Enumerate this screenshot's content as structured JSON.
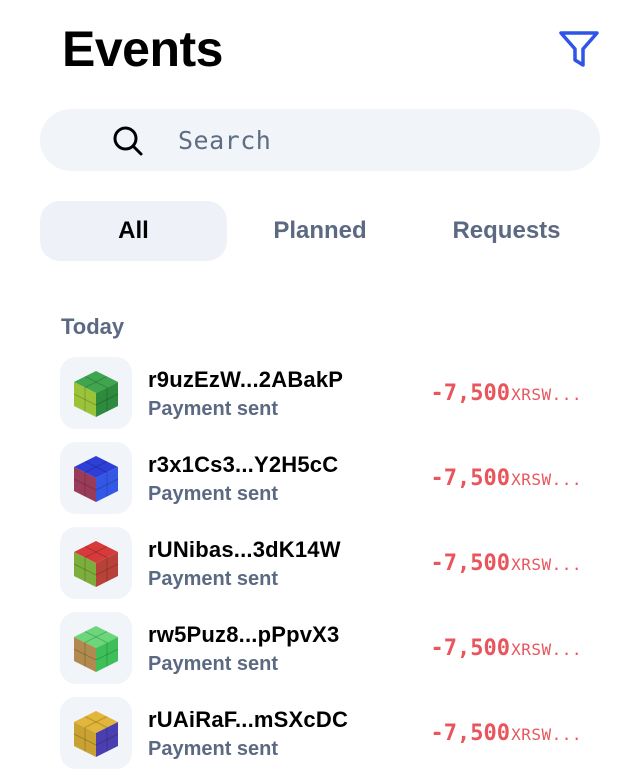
{
  "header": {
    "title": "Events",
    "filter_icon": "filter-funnel-icon",
    "accent": "#2f55e8"
  },
  "search": {
    "placeholder": "Search",
    "value": ""
  },
  "tabs": [
    {
      "label": "All",
      "active": true
    },
    {
      "label": "Planned",
      "active": false
    },
    {
      "label": "Requests",
      "active": false
    }
  ],
  "section": {
    "label": "Today"
  },
  "events": [
    {
      "address": "r9uzEzW...2ABakP",
      "description": "Payment sent",
      "amount": "-7,500",
      "currency": "XRSW...",
      "avatar_colors": [
        "#3fa64f",
        "#9bc33a",
        "#2e8a3c"
      ]
    },
    {
      "address": "r3x1Cs3...Y2H5cC",
      "description": "Payment sent",
      "amount": "-7,500",
      "currency": "XRSW...",
      "avatar_colors": [
        "#2d3fd6",
        "#9b3b5a",
        "#3358e6"
      ]
    },
    {
      "address": "rUNibas...3dK14W",
      "description": "Payment sent",
      "amount": "-7,500",
      "currency": "XRSW...",
      "avatar_colors": [
        "#d63a3a",
        "#7cae3c",
        "#b8423a"
      ]
    },
    {
      "address": "rw5Puz8...pPpvX3",
      "description": "Payment sent",
      "amount": "-7,500",
      "currency": "XRSW...",
      "avatar_colors": [
        "#6bd67a",
        "#b08a4e",
        "#3fbf5a"
      ]
    },
    {
      "address": "rUAiRaF...mSXcDC",
      "description": "Payment sent",
      "amount": "-7,500",
      "currency": "XRSW...",
      "avatar_colors": [
        "#e2b63a",
        "#c9a232",
        "#4a3fb0"
      ]
    }
  ],
  "colors": {
    "negative_amount": "#e8555c",
    "muted_text": "#5b6a82",
    "surface": "#f1f4f9"
  }
}
